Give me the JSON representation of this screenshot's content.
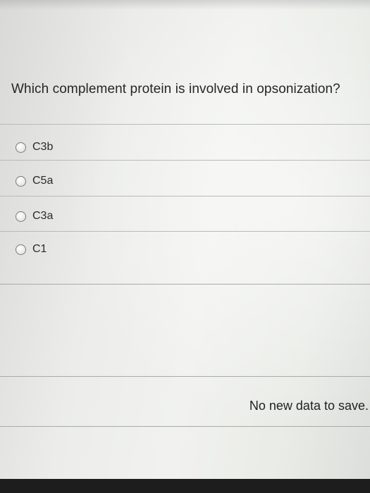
{
  "question": {
    "text": "Which complement protein is involved in opsonization?"
  },
  "options": [
    {
      "label": "C3b",
      "selected": false
    },
    {
      "label": "C5a",
      "selected": false
    },
    {
      "label": "C3a",
      "selected": false
    },
    {
      "label": "C1",
      "selected": false
    }
  ],
  "status": {
    "text": "No new data to save."
  },
  "colors": {
    "text": "#262626",
    "divider": "#b9bbb7",
    "radio_border": "#7a7c7a"
  }
}
